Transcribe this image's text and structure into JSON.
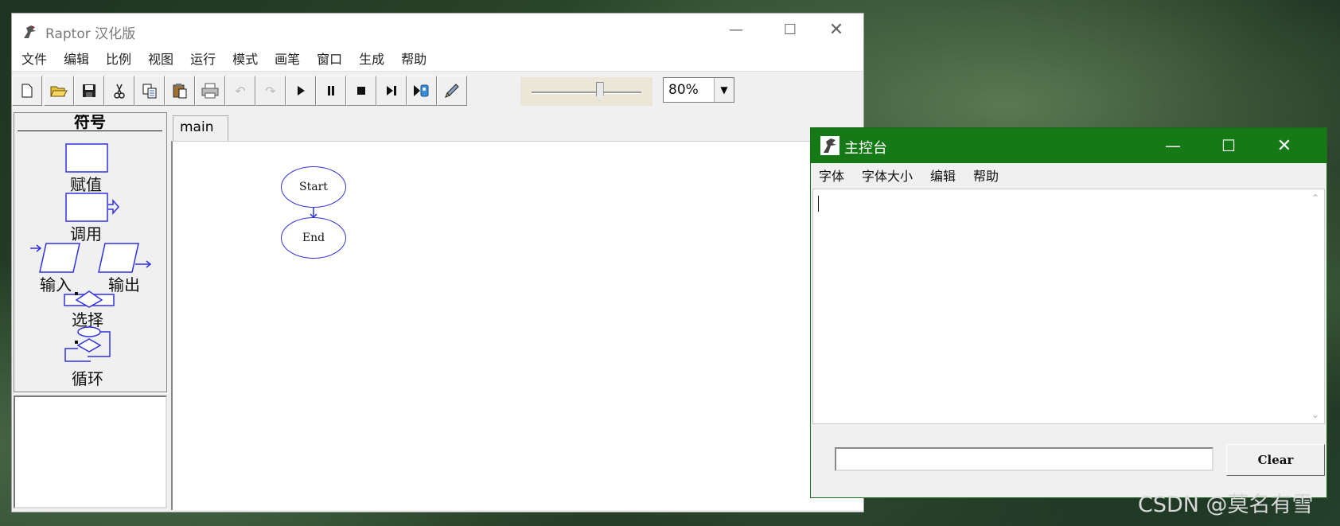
{
  "raptor": {
    "title": "Raptor 汉化版",
    "menu": [
      "文件",
      "编辑",
      "比例",
      "视图",
      "运行",
      "模式",
      "画笔",
      "窗口",
      "生成",
      "帮助"
    ],
    "toolbar_icons": [
      "new-icon",
      "open-icon",
      "save-icon",
      "cut-icon",
      "copy-icon",
      "paste-icon",
      "print-icon",
      "undo-icon",
      "redo-icon",
      "play-icon",
      "pause-icon",
      "stop-icon",
      "step-icon",
      "debug-icon",
      "pen-icon"
    ],
    "zoom": "80%",
    "slider_level": 0.63,
    "symbols_header": "符号",
    "symbols": {
      "assign": "赋值",
      "call": "调用",
      "input": "输入",
      "output": "输出",
      "select": "选择",
      "loop": "循环"
    },
    "tab": "main",
    "flow": {
      "start": "Start",
      "end": "End"
    }
  },
  "console": {
    "title": "主控台",
    "menu": [
      "字体",
      "字体大小",
      "编辑",
      "帮助"
    ],
    "input_value": "",
    "clear_label": "Clear"
  },
  "watermark": "CSDN @莫名有雪",
  "colors": {
    "console_title": "#157a15",
    "flow_stroke": "#3030e0"
  }
}
